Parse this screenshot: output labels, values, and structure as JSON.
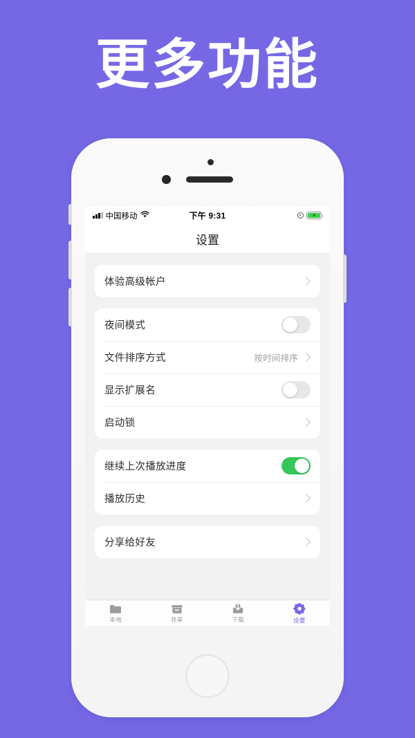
{
  "headline": "更多功能",
  "theme": {
    "background": "#7668e5",
    "accent": "#7668e5",
    "toggle_on": "#34c759",
    "toggle_off": "#e7e7e9",
    "screen_bg": "#f2f2f2"
  },
  "phone": {
    "status_bar": {
      "carrier": "中国移动",
      "time": "下午 9:31",
      "signal_icon": "signal-bars-icon",
      "wifi_icon": "wifi-icon",
      "location_icon": "location-services-icon",
      "battery_icon": "battery-charging-icon",
      "battery_charging": true
    },
    "navbar": {
      "title": "设置"
    },
    "groups": [
      {
        "rows": [
          {
            "label": "体验高级帐户",
            "type": "chevron",
            "value": ""
          }
        ]
      },
      {
        "rows": [
          {
            "label": "夜间模式",
            "type": "toggle",
            "on": false,
            "value": ""
          },
          {
            "label": "文件排序方式",
            "type": "chevron",
            "value": "按时间排序"
          },
          {
            "label": "显示扩展名",
            "type": "toggle",
            "on": false,
            "value": ""
          },
          {
            "label": "启动锁",
            "type": "chevron",
            "value": ""
          }
        ]
      },
      {
        "rows": [
          {
            "label": "继续上次播放进度",
            "type": "toggle",
            "on": true,
            "value": ""
          },
          {
            "label": "播放历史",
            "type": "chevron",
            "value": ""
          }
        ]
      },
      {
        "rows": [
          {
            "label": "分享给好友",
            "type": "chevron",
            "value": ""
          }
        ]
      }
    ],
    "tabbar": [
      {
        "label": "本地",
        "icon": "folder-icon",
        "active": false
      },
      {
        "label": "共享",
        "icon": "archive-box-icon",
        "active": false
      },
      {
        "label": "下载",
        "icon": "download-tray-icon",
        "active": false
      },
      {
        "label": "设置",
        "icon": "gear-icon",
        "active": true
      }
    ]
  }
}
